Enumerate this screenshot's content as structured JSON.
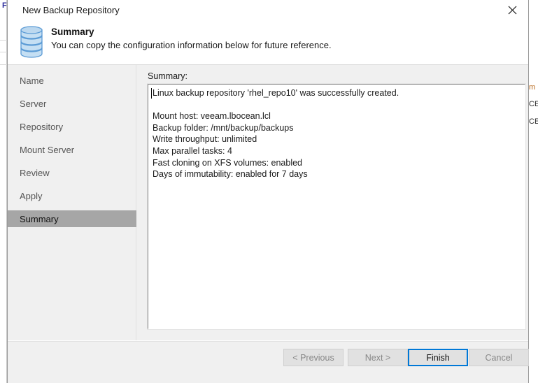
{
  "window": {
    "title": "New Backup Repository",
    "close_icon": "close-icon"
  },
  "header": {
    "icon": "database-repository-icon",
    "title": "Summary",
    "subtitle": "You can copy the configuration information below for future reference."
  },
  "sidebar": {
    "items": [
      {
        "label": "Name",
        "selected": false
      },
      {
        "label": "Server",
        "selected": false
      },
      {
        "label": "Repository",
        "selected": false
      },
      {
        "label": "Mount Server",
        "selected": false
      },
      {
        "label": "Review",
        "selected": false
      },
      {
        "label": "Apply",
        "selected": false
      },
      {
        "label": "Summary",
        "selected": true
      }
    ]
  },
  "content": {
    "summary_label": "Summary:",
    "summary_text": "Linux backup repository 'rhel_repo10' was successfully created.\n\nMount host: veeam.lbocean.lcl\nBackup folder: /mnt/backup/backups\nWrite throughput: unlimited\nMax parallel tasks: 4\nFast cloning on XFS volumes: enabled\nDays of immutability: enabled for 7 days"
  },
  "footer": {
    "buttons": [
      {
        "label": "< Previous",
        "enabled": false
      },
      {
        "label": "Next >",
        "enabled": false
      },
      {
        "label": "Finish",
        "enabled": true
      },
      {
        "label": "Cancel",
        "enabled": false
      }
    ]
  },
  "background": {
    "right_fragments": [
      "m |",
      "CEA",
      "CEA"
    ],
    "left_fragment": "F"
  },
  "colors": {
    "accent": "#0078d7",
    "dialog_body": "#f0f0f0",
    "selected_nav": "#a6a6a6",
    "icon_fill": "#bcd8ef",
    "icon_stroke": "#5b9bd5"
  }
}
